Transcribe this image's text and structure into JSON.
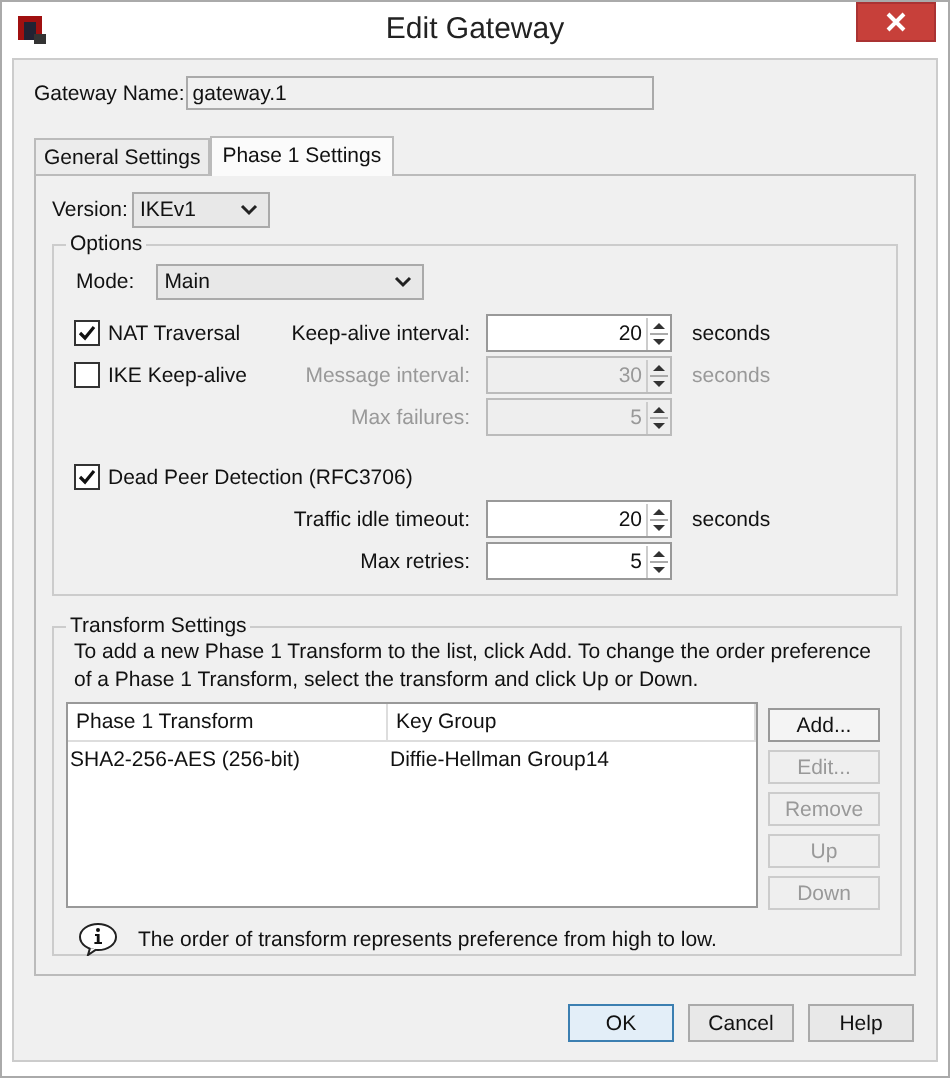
{
  "window": {
    "title": "Edit Gateway"
  },
  "gateway_name": {
    "label": "Gateway Name:",
    "value": "gateway.1"
  },
  "tabs": [
    {
      "label": "General Settings",
      "selected": false
    },
    {
      "label": "Phase 1 Settings",
      "selected": true
    }
  ],
  "version": {
    "label": "Version:",
    "value": "IKEv1"
  },
  "options": {
    "title": "Options",
    "mode": {
      "label": "Mode:",
      "value": "Main"
    },
    "rows": [
      {
        "checkbox": {
          "label": "NAT Traversal",
          "checked": true
        },
        "field": {
          "label": "Keep-alive interval:",
          "value": "20",
          "unit": "seconds",
          "disabled": false
        }
      },
      {
        "checkbox": {
          "label": "IKE Keep-alive",
          "checked": false
        },
        "field": {
          "label": "Message interval:",
          "value": "30",
          "unit": "seconds",
          "disabled": true
        }
      },
      {
        "field": {
          "label": "Max failures:",
          "value": "5",
          "disabled": true
        }
      },
      {
        "checkbox": {
          "label": "Dead Peer Detection (RFC3706)",
          "checked": true
        }
      },
      {
        "field": {
          "label": "Traffic idle timeout:",
          "value": "20",
          "unit": "seconds",
          "disabled": false
        }
      },
      {
        "field": {
          "label": "Max retries:",
          "value": "5",
          "disabled": false
        }
      }
    ]
  },
  "transform": {
    "title": "Transform Settings",
    "description": "To add a new Phase 1 Transform to the list, click Add. To change the order preference of a Phase 1 Transform, select the transform and click Up or Down.",
    "columns": [
      "Phase 1 Transform",
      "Key Group"
    ],
    "rows": [
      [
        "SHA2-256-AES (256-bit)",
        "Diffie-Hellman Group14"
      ]
    ],
    "buttons": [
      {
        "label": "Add...",
        "disabled": false
      },
      {
        "label": "Edit...",
        "disabled": true
      },
      {
        "label": "Remove",
        "disabled": true
      },
      {
        "label": "Up",
        "disabled": true
      },
      {
        "label": "Down",
        "disabled": true
      }
    ],
    "note": "The order of transform represents preference from high to low."
  },
  "buttons": [
    {
      "label": "OK",
      "default": true
    },
    {
      "label": "Cancel",
      "default": false
    },
    {
      "label": "Help",
      "default": false
    }
  ]
}
